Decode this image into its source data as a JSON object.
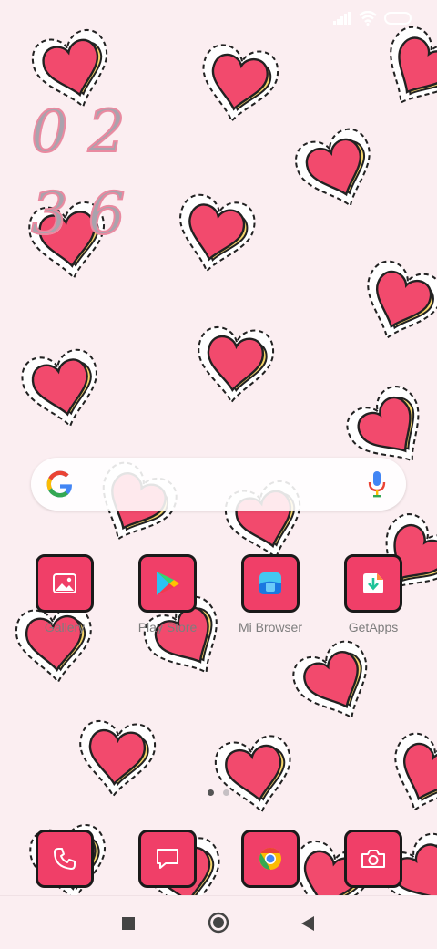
{
  "status_bar": {
    "signal_icon": "signal-icon",
    "wifi_icon": "wifi-icon",
    "battery_icon": "battery-icon"
  },
  "clock": {
    "hours": "02",
    "minutes": "36"
  },
  "search": {
    "google_icon": "google-g-icon",
    "mic_icon": "mic-icon"
  },
  "apps": [
    {
      "label": "Gallery",
      "icon": "gallery-icon"
    },
    {
      "label": "Play Store",
      "icon": "play-store-icon"
    },
    {
      "label": "Mi Browser",
      "icon": "mi-browser-icon"
    },
    {
      "label": "GetApps",
      "icon": "getapps-icon"
    }
  ],
  "dock": [
    {
      "name": "Phone",
      "icon": "phone-icon"
    },
    {
      "name": "Messages",
      "icon": "message-icon"
    },
    {
      "name": "Chrome",
      "icon": "chrome-icon"
    },
    {
      "name": "Camera",
      "icon": "camera-icon"
    }
  ],
  "page_indicator": {
    "current": 1,
    "total": 2
  },
  "nav": {
    "recents_icon": "recents-square-icon",
    "home_icon": "home-circle-icon",
    "back_icon": "back-triangle-icon"
  },
  "colors": {
    "tile": "#f03f68",
    "heart": "#f24a6d",
    "heart_rim": "#f4d66a",
    "background": "#fbeef1"
  }
}
